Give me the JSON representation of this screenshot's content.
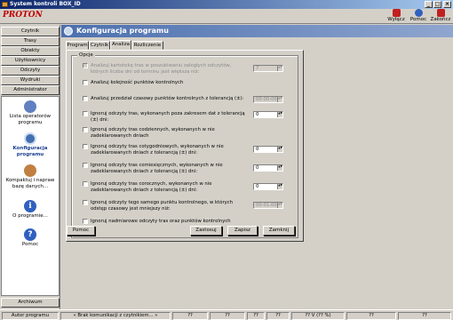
{
  "window": {
    "title": "System kontroli BOX_ID"
  },
  "toolbar": {
    "logo": "PROTON",
    "buttons": [
      {
        "label": "Wyłącz",
        "icon": "power-off-icon",
        "color": "#c02020"
      },
      {
        "label": "Pomoc",
        "icon": "help-icon",
        "color": "#3060c0"
      },
      {
        "label": "Zakończ",
        "icon": "close-icon",
        "color": "#c02020"
      }
    ]
  },
  "sidebar": {
    "nav_buttons": [
      "Czytnik",
      "Trasy",
      "Obiekty",
      "Użytkownicy",
      "Odczyty",
      "Wydruki",
      "Administrator"
    ],
    "items": [
      {
        "label": "Lista operatorów programu",
        "icon": "operators-icon"
      },
      {
        "label": "Konfiguracja programu",
        "icon": "config-icon"
      },
      {
        "label": "Kompaktuj i napraw bazę danych...",
        "icon": "repair-database-icon"
      },
      {
        "label": "O programie...",
        "icon": "info-icon"
      },
      {
        "label": "Pomoc",
        "icon": "help-icon"
      }
    ],
    "archive_button": "Archiwum"
  },
  "main": {
    "title": "Konfiguracja programu",
    "tabs": [
      "Program",
      "Czytnik",
      "Analiza",
      "Rozliczenie"
    ],
    "active_tab": "Analiza",
    "group_title": "Opcje",
    "options": [
      {
        "label": "Analizuj kartotekę tras w poszukiwaniu zaległych odczytów, których liczba dni od terminu jest większa niż:",
        "disabled": true,
        "value": "7"
      },
      {
        "label": "Analizuj kolejność punktów kontrolnych",
        "disabled": false,
        "value": null
      },
      {
        "label": "Analizuj przedział czasowy punktów kontrolnych z tolerancją (±):",
        "disabled": false,
        "value": "00:00:00"
      },
      {
        "label": "Ignoruj odczyty tras, wykonanych poza zakresem dat z tolerancją (±) dni:",
        "disabled": false,
        "value": "0"
      },
      {
        "label": "Ignoruj odczyty tras codziennych, wykonanych w nie zadeklarowanych dniach",
        "disabled": false,
        "value": null
      },
      {
        "label": "Ignoruj odczyty tras cotygodniowych, wykonanych w nie zadeklarowanych dniach z tolerancją (±) dni:",
        "disabled": false,
        "value": "0"
      },
      {
        "label": "Ignoruj odczyty tras comiesięcznych, wykonanych w nie zadeklarowanych dniach z tolerancją (±) dni:",
        "disabled": false,
        "value": "0"
      },
      {
        "label": "Ignoruj odczyty tras corocznych, wykonanych w nie zadeklarowanych dniach z tolerancją (±) dni:",
        "disabled": false,
        "value": "0"
      },
      {
        "label": "Ignoruj odczyty tego samego punktu kontrolnego, w których odstęp czasowy jest mniejszy niż:",
        "disabled": false,
        "value": "00:01:00"
      },
      {
        "label": "Ignoruj nadmiarowe odczyty tras oraz punktów kontrolnych",
        "disabled": false,
        "value": null
      }
    ],
    "buttons": {
      "help": "Pomoc",
      "apply": "Zastosuj",
      "save": "Zapisz",
      "close": "Zamknij"
    }
  },
  "statusbar": [
    "Autor programu",
    "« Brak komunikacji z czytnikiem... »",
    "??",
    "??",
    "??",
    "??",
    "?? V (?? %)",
    "??",
    "??"
  ]
}
